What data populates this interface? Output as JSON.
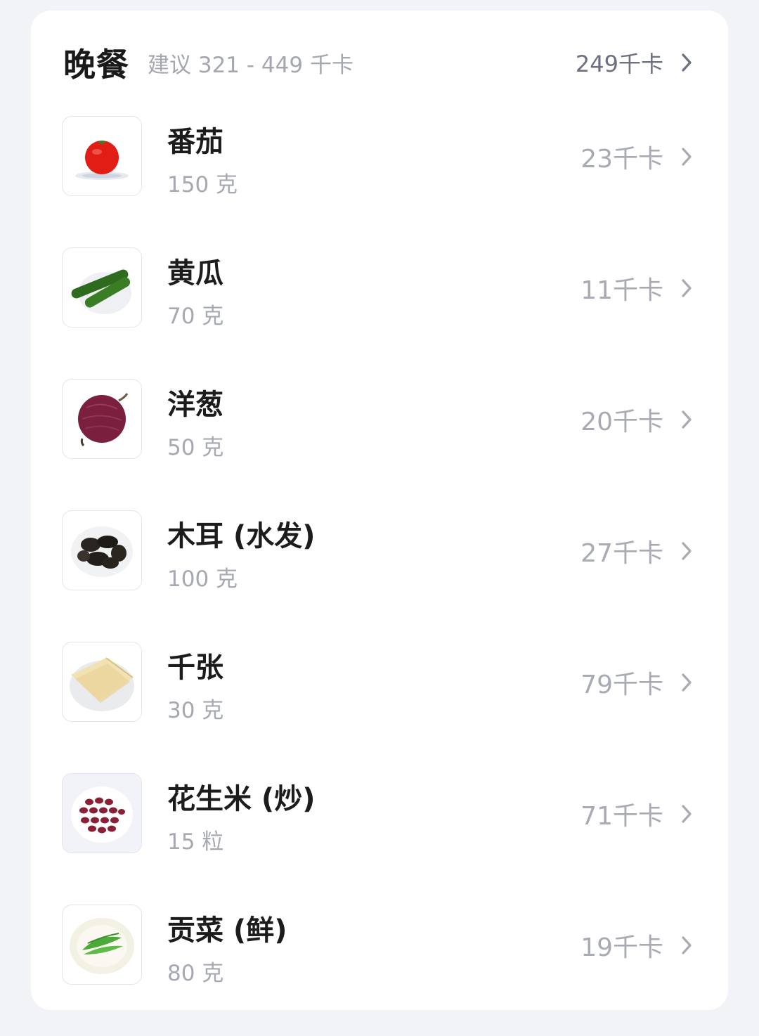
{
  "meal": {
    "title": "晚餐",
    "suggestion": "建议 321 - 449 千卡",
    "total": "249千卡"
  },
  "items": [
    {
      "name": "番茄",
      "amount": "150 克",
      "kcal": "23千卡",
      "icon": "tomato-icon"
    },
    {
      "name": "黄瓜",
      "amount": "70 克",
      "kcal": "11千卡",
      "icon": "cucumber-icon"
    },
    {
      "name": "洋葱",
      "amount": "50 克",
      "kcal": "20千卡",
      "icon": "onion-icon"
    },
    {
      "name": "木耳 (水发)",
      "amount": "100 克",
      "kcal": "27千卡",
      "icon": "wood-ear-icon"
    },
    {
      "name": "千张",
      "amount": "30 克",
      "kcal": "79千卡",
      "icon": "tofu-skin-icon"
    },
    {
      "name": "花生米 (炒)",
      "amount": "15 粒",
      "kcal": "71千卡",
      "icon": "peanut-icon"
    },
    {
      "name": "贡菜 (鲜)",
      "amount": "80 克",
      "kcal": "19千卡",
      "icon": "celtuce-greens-icon"
    }
  ],
  "colors": {
    "background": "#f2f3f7",
    "card": "#ffffff",
    "title": "#1a1a1a",
    "muted": "#a4a7b0",
    "total": "#6c7080"
  }
}
